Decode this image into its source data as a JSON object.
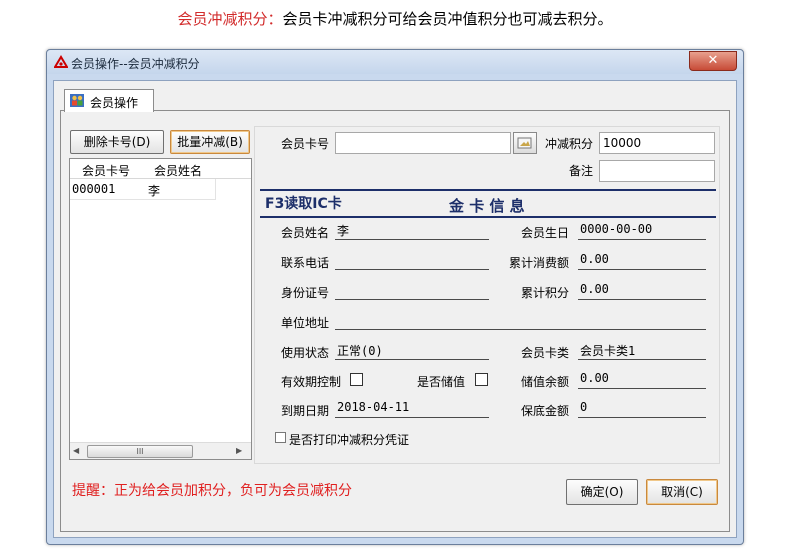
{
  "caption": {
    "highlight": "会员冲减积分：",
    "text": "会员卡冲减积分可给会员冲值积分也可减去积分。"
  },
  "window": {
    "title": "会员操作--会员冲减积分",
    "close_label": "✕"
  },
  "tab": {
    "label": "会员操作"
  },
  "left": {
    "delete_button": "删除卡号(D)",
    "batch_button": "批量冲减(B)",
    "columns": [
      "会员卡号",
      "会员姓名"
    ],
    "rows": [
      {
        "card": "000001",
        "name": "李"
      }
    ],
    "scroll_thumb": "III"
  },
  "form": {
    "card_no_label": "会员卡号",
    "card_no_value": "",
    "deduct_label": "冲减积分",
    "deduct_value": "10000",
    "remark_label": "备注",
    "remark_value": ""
  },
  "card_info": {
    "f3_label": "F3读取IC卡",
    "title": "金 卡 信 息",
    "name_label": "会员姓名",
    "name_value": "李",
    "birthday_label": "会员生日",
    "birthday_value": "0000-00-00",
    "phone_label": "联系电话",
    "phone_value": "",
    "total_spend_label": "累计消费额",
    "total_spend_value": "0.00",
    "id_label": "身份证号",
    "id_value": "",
    "total_points_label": "累计积分",
    "total_points_value": "0.00",
    "address_label": "单位地址",
    "address_value": "",
    "status_label": "使用状态",
    "status_value": "正常(0)",
    "card_type_label": "会员卡类",
    "card_type_value": "会员卡类1",
    "validity_label": "有效期控制",
    "stored_label": "是否储值",
    "balance_label": "储值余额",
    "balance_value": "0.00",
    "expiry_label": "到期日期",
    "expiry_value": "2018-04-11",
    "min_balance_label": "保底金额",
    "min_balance_value": "0"
  },
  "print_voucher_label": "是否打印冲减积分凭证",
  "tip": "提醒：正为给会员加积分，负可为会员减积分",
  "ok_button": "确定(O)",
  "cancel_button": "取消(C)",
  "colors": {
    "tip": "#e02020",
    "caption_highlight": "#d22b2b",
    "navy": "#1d2f6a"
  }
}
